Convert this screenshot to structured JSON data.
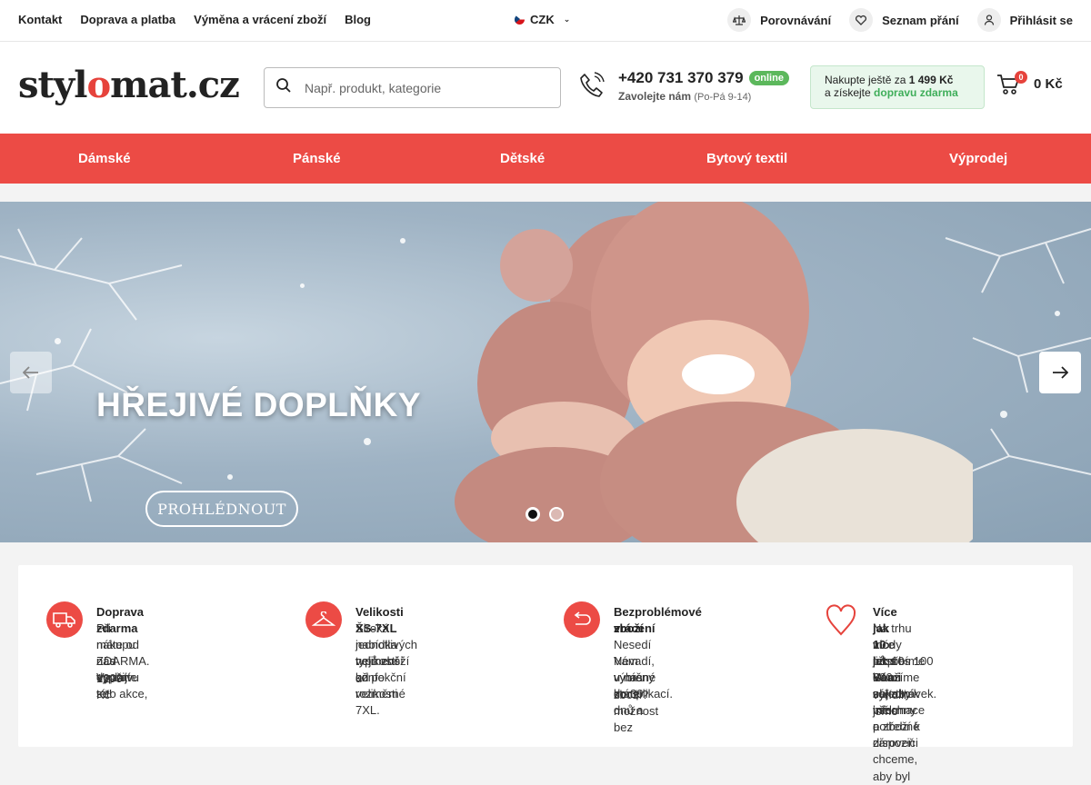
{
  "topbar": {
    "links": [
      "Kontakt",
      "Doprava a platba",
      "Výměna a vrácení zboží",
      "Blog"
    ],
    "currency": "CZK",
    "compare": "Porovnávání",
    "wishlist": "Seznam přání",
    "login": "Přihlásit se"
  },
  "header": {
    "logo_start": "styl",
    "logo_heart": "o",
    "logo_end": "mat.cz",
    "search_placeholder": "Např. produkt, kategorie",
    "phone": "+420 731 370 379",
    "online_badge": "online",
    "call_label": "Zavolejte nám",
    "call_hours": "(Po-Pá 9-14)",
    "freeship_line1_pre": "Nakupte ještě za",
    "freeship_amount": "1 499 Kč",
    "freeship_line2_pre": "a získejte",
    "freeship_green": "dopravu zdarma",
    "cart_count": "0",
    "cart_total": "0 Kč"
  },
  "nav": {
    "items": [
      "Dámské",
      "Pánské",
      "Dětské",
      "Bytový textil",
      "Výprodej"
    ]
  },
  "banner": {
    "title": "HŘEJIVÉ DOPLŇKY",
    "button": "PROHLÉDNOUT",
    "slides": 2,
    "active_slide": 1
  },
  "features": [
    {
      "icon": "truck-icon",
      "title": "Doprava zdarma",
      "lines": [
        "Při nákupu nad 1299 Kč",
        "máte od nás dopravu",
        "ZDARMA. Využijte této akce,",
        "vyplatí se!"
      ]
    },
    {
      "icon": "hanger-icon",
      "title": "Velikosti XS-7XL",
      "lines": [
        "Široká nabídka velikostí u",
        "jednotlivých typů zboží od",
        "nejmenší konfekční velikosti",
        "až po rozměrné 7XL."
      ]
    },
    {
      "icon": "return-icon",
      "title_lines": [
        "Bezproblémové vrácení",
        "zboží"
      ],
      "lines": [
        "Nesedí Vám vybrané zboží?",
        "Nevadí, u nás máte možnost",
        "výměny do 30 dnů a bez",
        "komplikací."
      ]
    },
    {
      "icon": "heart-icon",
      "title": "Více jak 10 let s Vámi",
      "lines": [
        "Na trhu módy působíme",
        "více jak 10 let a vyřídili jsme",
        "již přes 100 000 objednávek.",
        "Snažíme se, aby měl",
        "zákazník všechny potřebné",
        "informace o zboží k dispozici",
        "a zároveň chceme, aby byl"
      ]
    }
  ],
  "colors": {
    "accent": "#ec4b45",
    "green": "#3fae5a"
  }
}
